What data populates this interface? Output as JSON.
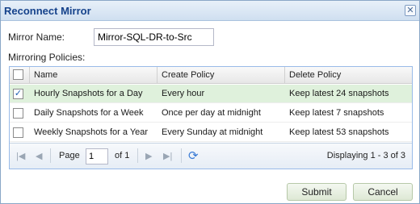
{
  "dialog": {
    "title": "Reconnect Mirror",
    "close_glyph": "✕"
  },
  "form": {
    "mirror_name_label": "Mirror Name:",
    "mirror_name_value": "Mirror-SQL-DR-to-Src",
    "policies_label": "Mirroring Policies:"
  },
  "grid": {
    "columns": [
      "Name",
      "Create Policy",
      "Delete Policy"
    ],
    "rows": [
      {
        "checked": true,
        "name": "Hourly Snapshots for a Day",
        "create": "Every hour",
        "delete": "Keep latest 24 snapshots"
      },
      {
        "checked": false,
        "name": "Daily Snapshots for a Week",
        "create": "Once per day at midnight",
        "delete": "Keep latest 7 snapshots"
      },
      {
        "checked": false,
        "name": "Weekly Snapshots for a Year",
        "create": "Every Sunday at midnight",
        "delete": "Keep latest 53 snapshots"
      }
    ]
  },
  "pager": {
    "page_label": "Page",
    "page_value": "1",
    "of_label": "of 1",
    "display_text": "Displaying 1 - 3 of 3"
  },
  "buttons": {
    "submit": "Submit",
    "cancel": "Cancel"
  },
  "icons": {
    "check": "✓",
    "refresh": "⟳"
  }
}
